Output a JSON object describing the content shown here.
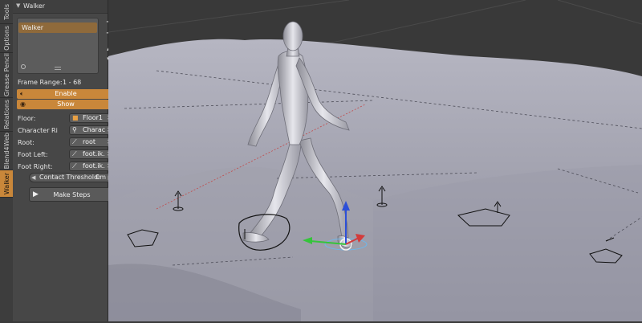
{
  "tabs": [
    "Tools",
    "Options",
    "Grease Pencil",
    "Relations",
    "Blend4Web",
    "Walker"
  ],
  "active_tab": "Walker",
  "panel": {
    "title": "Walker",
    "list_item": "Walker",
    "frame_range_label": "Frame Range:",
    "frame_range_value": "1 - 68",
    "enable_label": "Enable",
    "show_label": "Show",
    "fields": [
      {
        "label": "Floor:",
        "value": "Floor1",
        "icon": "cube-icon"
      },
      {
        "label": "Character Ri",
        "value": "Characte",
        "icon": "armature-icon"
      },
      {
        "label": "Root:",
        "value": "root",
        "icon": "bone-icon"
      },
      {
        "label": "Foot Left:",
        "value": "foot.ik.L",
        "icon": "bone-icon"
      },
      {
        "label": "Foot Right:",
        "value": "foot.ik.R",
        "icon": "bone-icon"
      }
    ],
    "threshold_label": "Contact Threshold:",
    "threshold_value": "0m",
    "make_steps": "Make Steps"
  },
  "colors": {
    "accent": "#c9873a",
    "panel": "#474747",
    "floor": "#a9a9b6",
    "background": "#393939"
  }
}
